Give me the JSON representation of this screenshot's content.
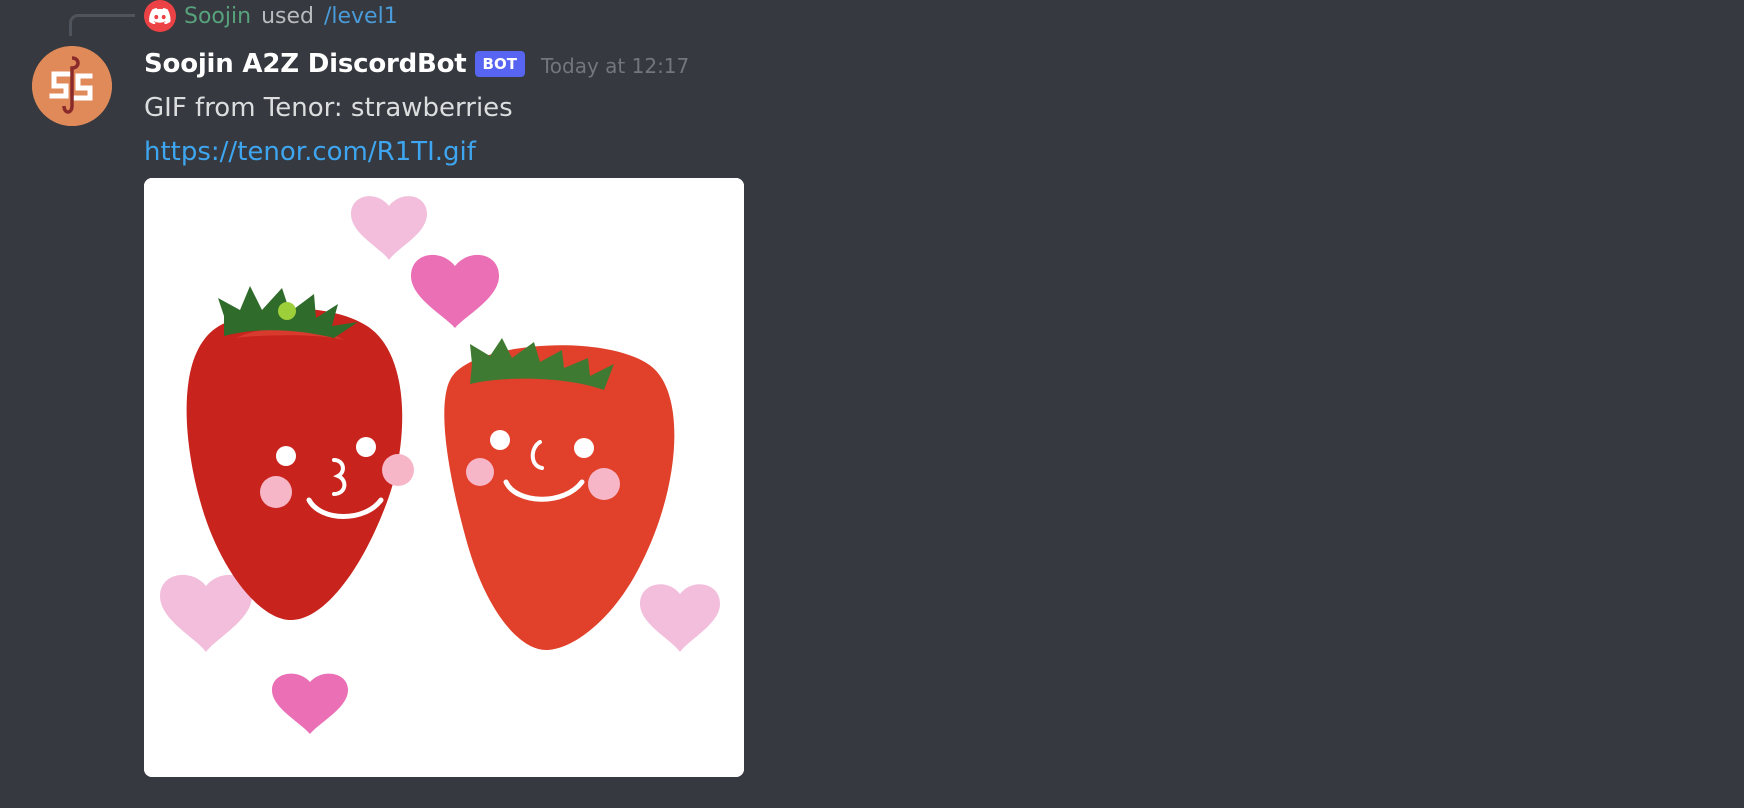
{
  "reply": {
    "user": "Soojin",
    "used_text": "used",
    "command": "/level1",
    "icon": "discord-logo-icon"
  },
  "message": {
    "avatar_icon": "soojin-logo-avatar",
    "username": "Soojin A2Z DiscordBot",
    "badge": "BOT",
    "timestamp": "Today at 12:17",
    "content": "GIF from Tenor: strawberries",
    "link": "https://tenor.com/R1TI.gif"
  },
  "embed": {
    "description": "strawberries gif",
    "icons": [
      "strawberry-left",
      "strawberry-right",
      "heart"
    ]
  },
  "colors": {
    "background": "#36393f",
    "reply_user": "#57a27c",
    "reply_command": "#4a9bd9",
    "badge": "#5865f2",
    "link": "#3ea6f0",
    "avatar": "#e08a5a"
  }
}
